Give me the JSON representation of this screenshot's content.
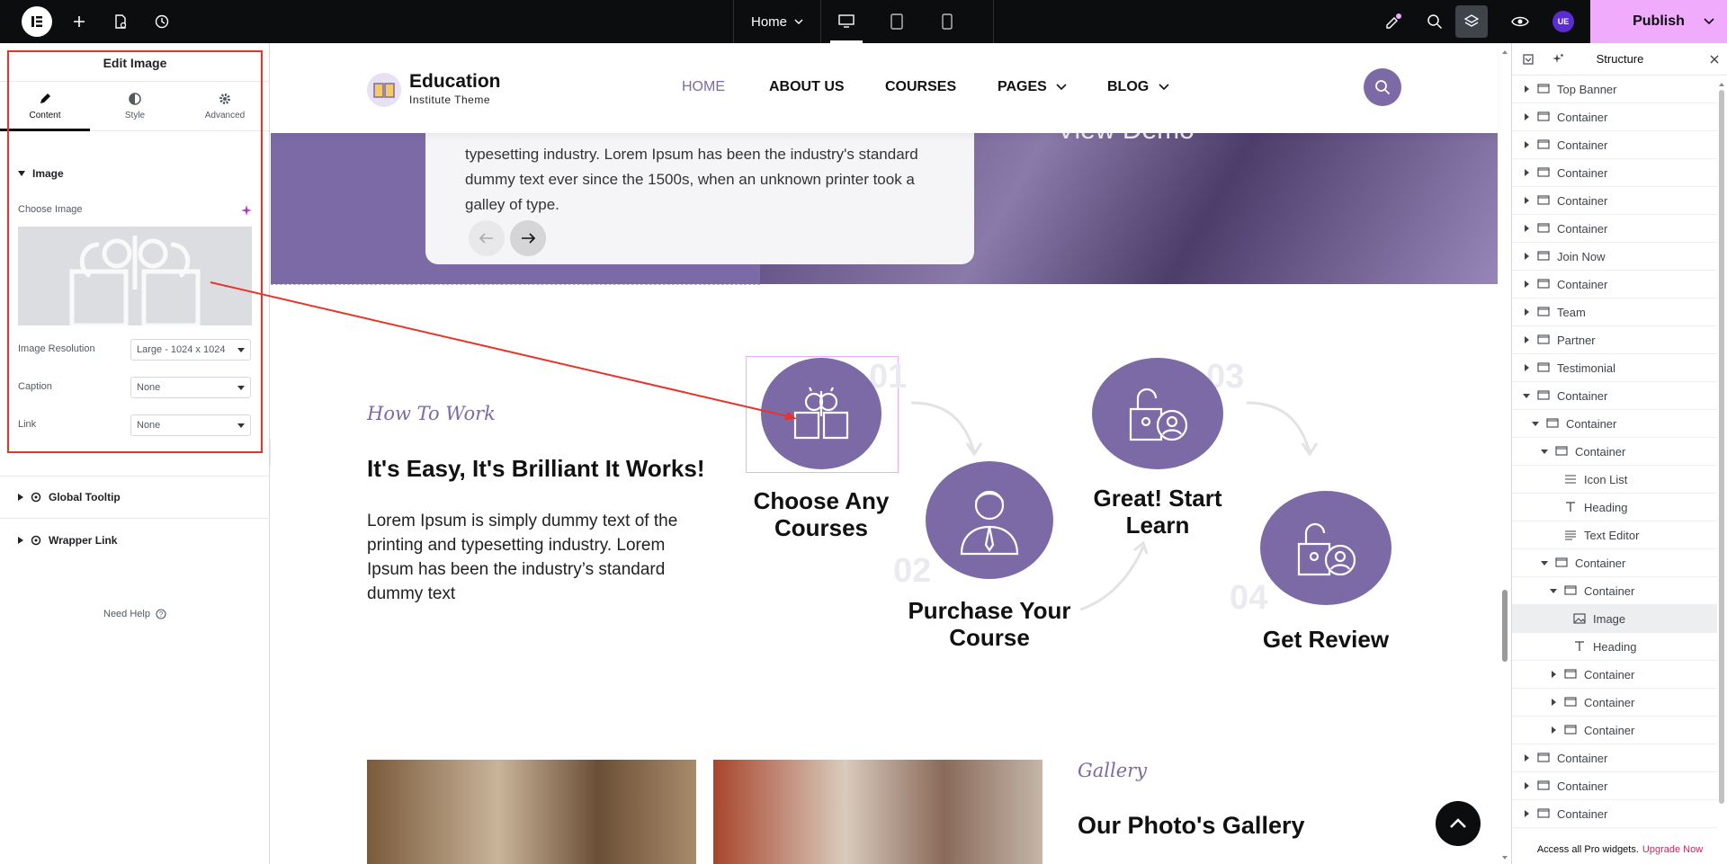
{
  "topbar": {
    "document_label": "Home",
    "publish_label": "Publish",
    "user_initials": "UE",
    "accent_color": "#f0abfc",
    "icons": [
      "elementor-logo-icon",
      "add-icon",
      "page-settings-icon",
      "history-icon",
      "chevron-down-icon",
      "desktop-icon",
      "tablet-icon",
      "mobile-icon",
      "whats-new-icon",
      "search-icon",
      "structure-icon",
      "preview-icon"
    ]
  },
  "left_panel": {
    "title": "Edit Image",
    "tabs": [
      {
        "label": "Content",
        "icon": "pencil-icon",
        "active": true
      },
      {
        "label": "Style",
        "icon": "half-circle-icon",
        "active": false
      },
      {
        "label": "Advanced",
        "icon": "gear-icon",
        "active": false
      }
    ],
    "section_image": "Image",
    "choose_image_label": "Choose Image",
    "resolution_label": "Image Resolution",
    "resolution_value": "Large - 1024 x 1024",
    "caption_label": "Caption",
    "caption_value": "None",
    "link_label": "Link",
    "link_value": "None",
    "global_tooltip": "Global Tooltip",
    "wrapper_link": "Wrapper Link",
    "need_help": "Need Help"
  },
  "site": {
    "brand_title": "Education",
    "brand_subtitle": "Institute Theme",
    "brand_color": "#7c6aa6",
    "menu": [
      {
        "label": "HOME",
        "active": true
      },
      {
        "label": "ABOUT US",
        "active": false
      },
      {
        "label": "COURSES",
        "active": false
      },
      {
        "label": "PAGES",
        "active": false
      },
      {
        "label": "BLOG",
        "active": false
      }
    ],
    "hero_text": "typesetting industry. Lorem Ipsum has been the industry's standard dummy text ever since the 1500s, when an unknown printer took a galley of type.",
    "view_demo": "View Demo",
    "how_subtitle": "How To Work",
    "how_headline": "It's Easy, It's Brilliant It Works!",
    "how_body": "Lorem Ipsum is simply dummy text of the printing and typesetting industry. Lorem Ipsum has been the industry’s standard dummy text",
    "steps": [
      {
        "num": "01",
        "title": "Choose Any Courses",
        "icon": "brain-book-icon"
      },
      {
        "num": "02",
        "title": "Purchase Your Course",
        "icon": "student-icon"
      },
      {
        "num": "03",
        "title": "Great! Start Learn",
        "icon": "unlock-user-icon"
      },
      {
        "num": "04",
        "title": "Get Review",
        "icon": "unlock-user-icon"
      }
    ],
    "gallery_subtitle": "Gallery",
    "gallery_headline": "Our Photo's Gallery"
  },
  "structure": {
    "title": "Structure",
    "items": [
      {
        "label": "Top Banner",
        "depth": 0,
        "expanded": false,
        "icon": "container-icon"
      },
      {
        "label": "Container",
        "depth": 0,
        "expanded": false,
        "icon": "container-icon"
      },
      {
        "label": "Container",
        "depth": 0,
        "expanded": false,
        "icon": "container-icon"
      },
      {
        "label": "Container",
        "depth": 0,
        "expanded": false,
        "icon": "container-icon"
      },
      {
        "label": "Container",
        "depth": 0,
        "expanded": false,
        "icon": "container-icon"
      },
      {
        "label": "Container",
        "depth": 0,
        "expanded": false,
        "icon": "container-icon"
      },
      {
        "label": "Join Now",
        "depth": 0,
        "expanded": false,
        "icon": "container-icon"
      },
      {
        "label": "Container",
        "depth": 0,
        "expanded": false,
        "icon": "container-icon"
      },
      {
        "label": "Team",
        "depth": 0,
        "expanded": false,
        "icon": "container-icon"
      },
      {
        "label": "Partner",
        "depth": 0,
        "expanded": false,
        "icon": "container-icon"
      },
      {
        "label": "Testimonial",
        "depth": 0,
        "expanded": false,
        "icon": "container-icon"
      },
      {
        "label": "Container",
        "depth": 0,
        "expanded": true,
        "icon": "container-icon"
      },
      {
        "label": "Container",
        "depth": 1,
        "expanded": true,
        "icon": "container-icon"
      },
      {
        "label": "Container",
        "depth": 2,
        "expanded": true,
        "icon": "container-icon"
      },
      {
        "label": "Icon List",
        "depth": 3,
        "leaf": true,
        "icon": "list-icon"
      },
      {
        "label": "Heading",
        "depth": 3,
        "leaf": true,
        "icon": "heading-icon"
      },
      {
        "label": "Text Editor",
        "depth": 3,
        "leaf": true,
        "icon": "text-icon"
      },
      {
        "label": "Container",
        "depth": 2,
        "expanded": true,
        "icon": "container-icon"
      },
      {
        "label": "Container",
        "depth": 3,
        "expanded": true,
        "icon": "container-icon"
      },
      {
        "label": "Image",
        "depth": 4,
        "leaf": true,
        "icon": "image-icon",
        "selected": true
      },
      {
        "label": "Heading",
        "depth": 4,
        "leaf": true,
        "icon": "heading-icon"
      },
      {
        "label": "Container",
        "depth": 3,
        "expanded": false,
        "icon": "container-icon"
      },
      {
        "label": "Container",
        "depth": 3,
        "expanded": false,
        "icon": "container-icon"
      },
      {
        "label": "Container",
        "depth": 3,
        "expanded": false,
        "icon": "container-icon"
      },
      {
        "label": "Container",
        "depth": 0,
        "expanded": false,
        "icon": "container-icon"
      },
      {
        "label": "Container",
        "depth": 0,
        "expanded": false,
        "icon": "container-icon"
      },
      {
        "label": "Container",
        "depth": 0,
        "expanded": false,
        "icon": "container-icon"
      },
      {
        "label": "Container",
        "depth": 0,
        "expanded": false,
        "icon": "container-icon"
      }
    ],
    "footer_text": "Access all Pro widgets.",
    "footer_link": "Upgrade Now"
  }
}
